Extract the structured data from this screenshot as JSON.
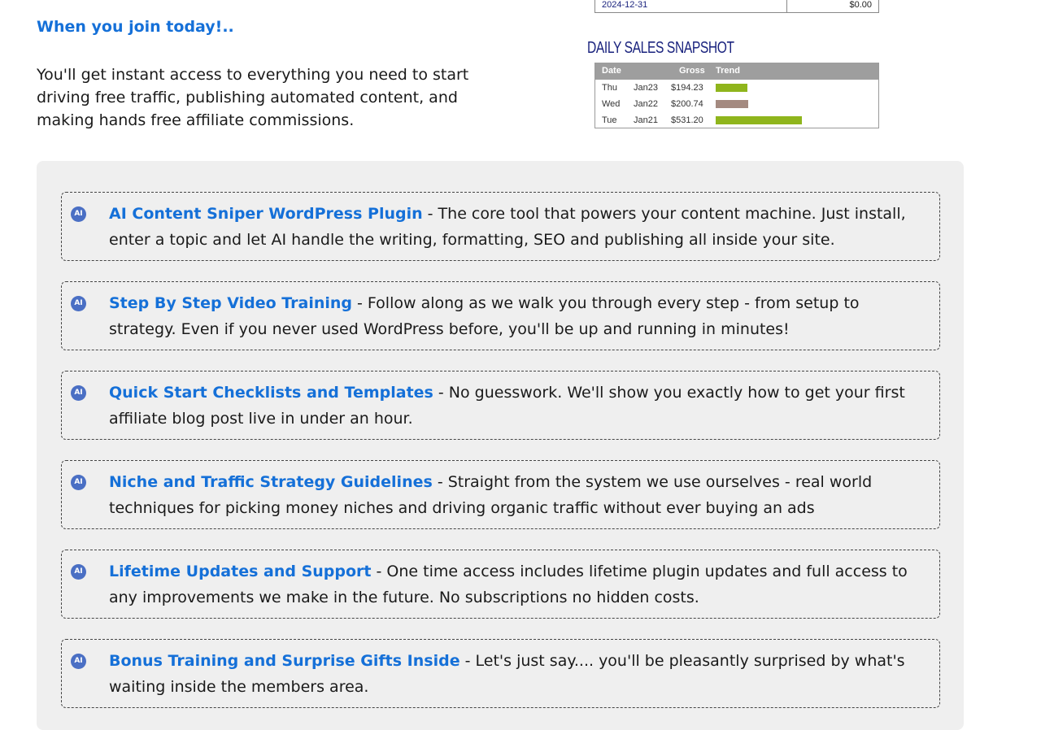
{
  "intro": {
    "heading": "When you join today!..",
    "text": "You'll get instant access to everything you need to start driving free traffic, publishing automated content, and making hands free affiliate commissions."
  },
  "snapshot": {
    "top_row": {
      "date": "2024-12-31",
      "amount": "$0.00"
    },
    "title": "DAILY SALES SNAPSHOT",
    "headers": [
      "Date",
      "Gross",
      "Trend"
    ],
    "rows": [
      {
        "day": "Thu",
        "date": "Jan23",
        "gross": "$194.23",
        "trend": 194.23,
        "color": "#8fb51c"
      },
      {
        "day": "Wed",
        "date": "Jan22",
        "gross": "$200.74",
        "trend": 200.74,
        "color": "#a48a80"
      },
      {
        "day": "Tue",
        "date": "Jan21",
        "gross": "$531.20",
        "trend": 531.2,
        "color": "#8fb51c"
      }
    ]
  },
  "features": [
    {
      "icon": "ai-badge-icon",
      "title": "AI Content Sniper WordPress Plugin",
      "description": " - The core tool that powers your content machine. Just install, enter a topic and let AI handle the writing, formatting, SEO and publishing all inside your site."
    },
    {
      "icon": "ai-badge-icon",
      "title": "Step By Step Video Training",
      "description": " - Follow along as we walk you through every step - from setup to strategy. Even if you never used WordPress before, you'll be up and running in minutes!"
    },
    {
      "icon": "ai-badge-icon",
      "title": "Quick Start Checklists and Templates",
      "description": " - No guesswork.  We'll show you exactly how to get your first affiliate blog post live in under an hour."
    },
    {
      "icon": "ai-badge-icon",
      "title": "Niche and Traffic Strategy Guidelines",
      "description": " - Straight from the system we use ourselves - real world techniques for picking money niches and driving organic traffic without ever buying an ads"
    },
    {
      "icon": "ai-badge-icon",
      "title": "Lifetime Updates and Support",
      "description": " - One time access includes lifetime plugin updates and full access to any improvements we make in the future.  No subscriptions no hidden costs."
    },
    {
      "icon": "ai-badge-icon",
      "title": "Bonus Training and Surprise Gifts Inside",
      "description": " - Let's just say.... you'll be pleasantly surprised by what's waiting inside the members area."
    }
  ],
  "icon_label": "AI",
  "colors": {
    "accent": "#1570d8",
    "panel": "#efefef",
    "snapshot_title": "#1a237e"
  }
}
